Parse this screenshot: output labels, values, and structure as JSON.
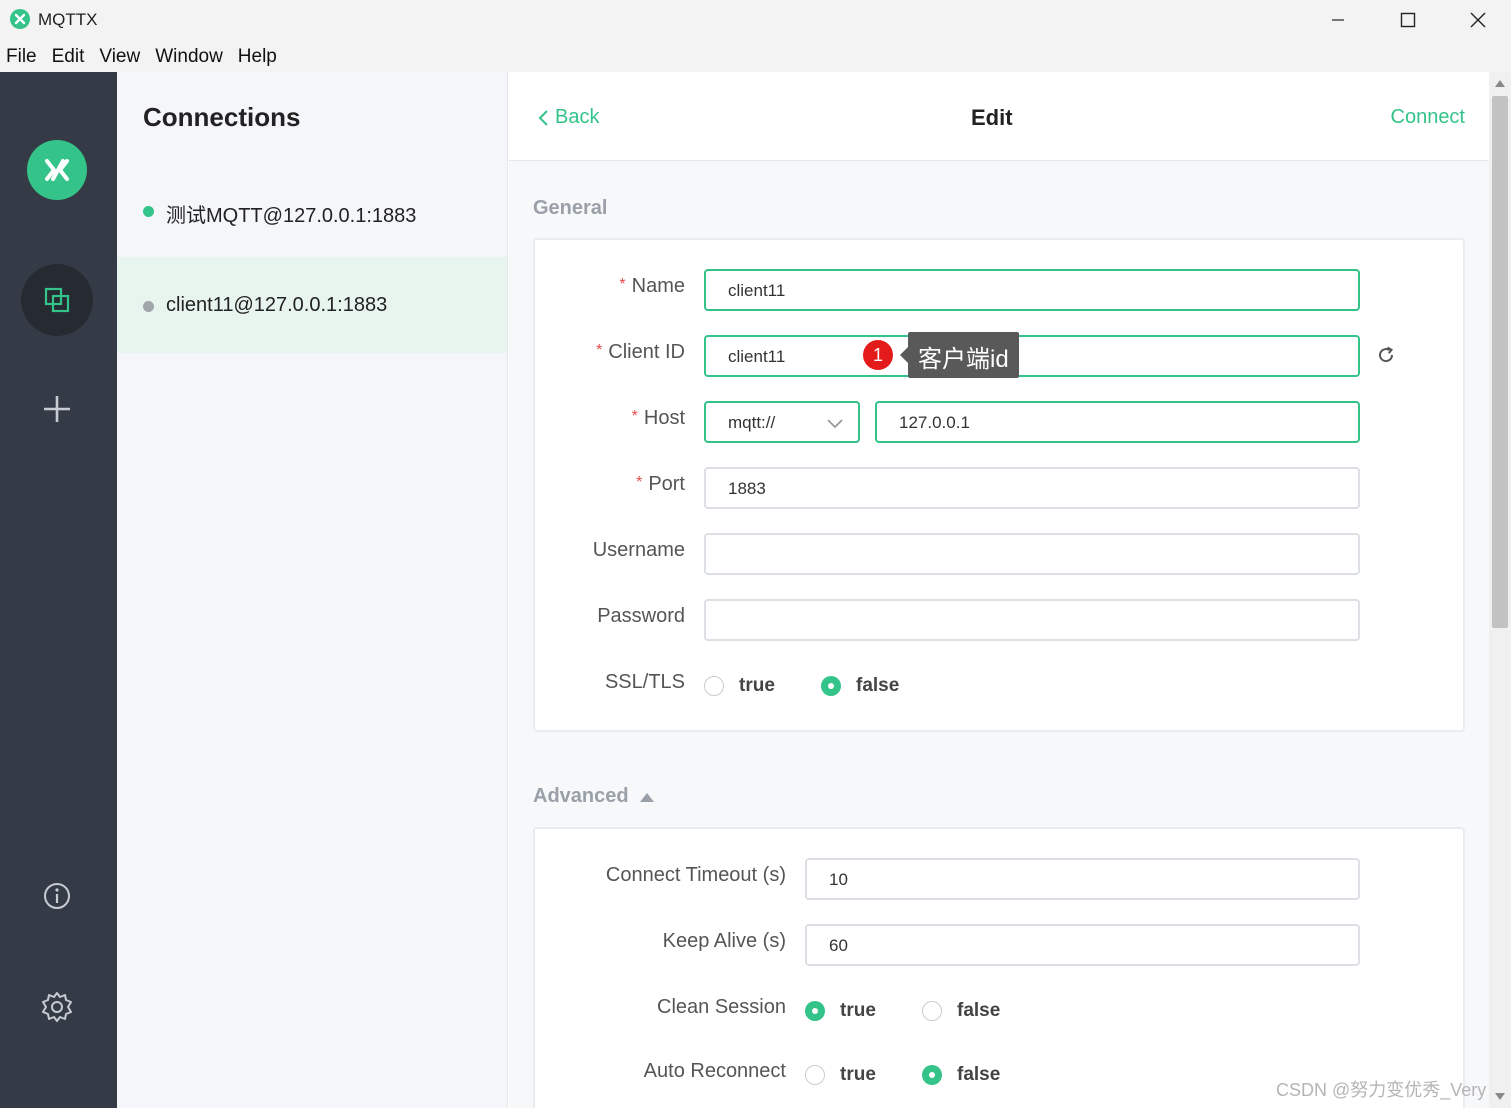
{
  "window": {
    "title": "MQTTX"
  },
  "menu": [
    "File",
    "Edit",
    "View",
    "Window",
    "Help"
  ],
  "nav": {
    "icons": [
      "mqttx-logo-icon",
      "connections-icon",
      "plus-icon",
      "info-icon",
      "gear-icon"
    ]
  },
  "connections": {
    "title": "Connections",
    "items": [
      {
        "label": "测试MQTT@127.0.0.1:1883",
        "status_color": "#34c388",
        "active": false
      },
      {
        "label": "client11@127.0.0.1:1883",
        "status_color": "#a0a4ab",
        "active": true
      }
    ]
  },
  "header": {
    "back": "Back",
    "title": "Edit",
    "connect": "Connect"
  },
  "general": {
    "title": "General",
    "name": {
      "label": "Name",
      "value": "client11",
      "required": true
    },
    "client_id": {
      "label": "Client ID",
      "value": "client11",
      "required": true
    },
    "host": {
      "label": "Host",
      "protocol": "mqtt://",
      "value": "127.0.0.1",
      "required": true
    },
    "port": {
      "label": "Port",
      "value": "1883",
      "required": true
    },
    "username": {
      "label": "Username",
      "value": ""
    },
    "password": {
      "label": "Password",
      "value": ""
    },
    "ssl_tls": {
      "label": "SSL/TLS",
      "options": [
        "true",
        "false"
      ],
      "selected": "false"
    }
  },
  "annotation": {
    "badge": "1",
    "tooltip": "客户端id"
  },
  "advanced": {
    "title": "Advanced",
    "connect_timeout": {
      "label": "Connect Timeout (s)",
      "value": "10"
    },
    "keep_alive": {
      "label": "Keep Alive (s)",
      "value": "60"
    },
    "clean_session": {
      "label": "Clean Session",
      "options": [
        "true",
        "false"
      ],
      "selected": "true"
    },
    "auto_reconnect": {
      "label": "Auto Reconnect",
      "options": [
        "true",
        "false"
      ],
      "selected": "false"
    }
  },
  "watermark": "CSDN @努力变优秀_Very",
  "colors": {
    "accent": "#34c388",
    "nav_bg": "#353b46",
    "required": "#e84a4a"
  }
}
